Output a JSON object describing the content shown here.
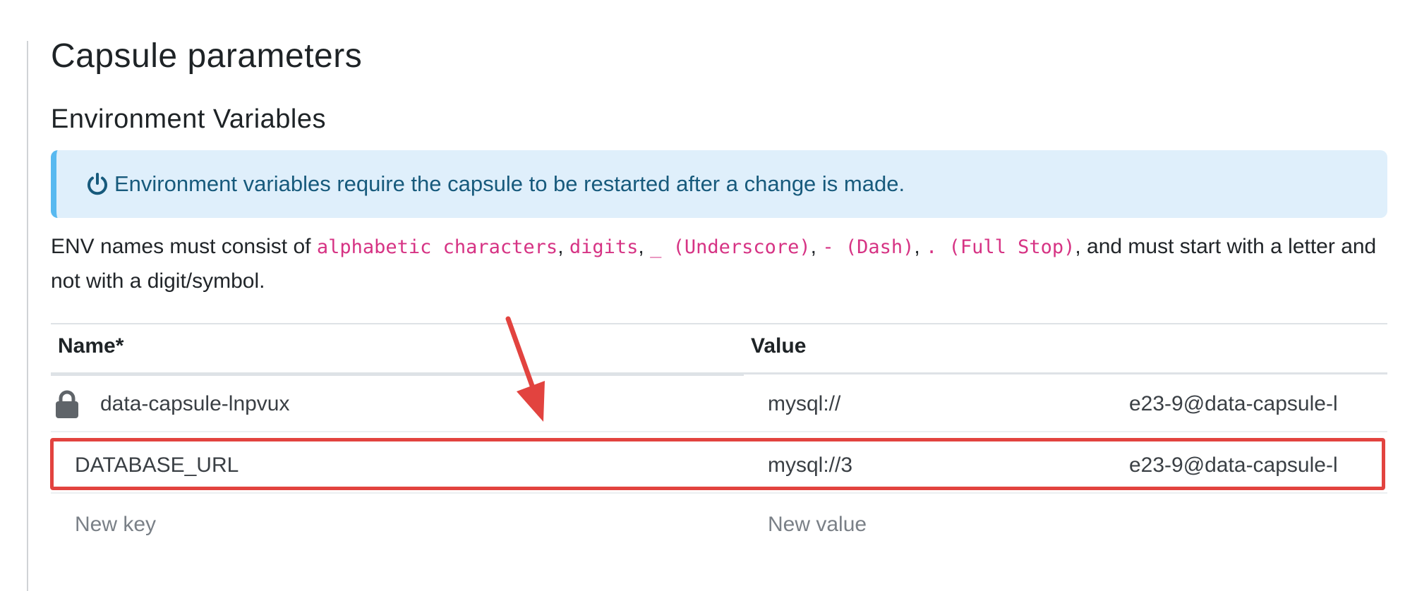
{
  "page": {
    "title": "Capsule parameters",
    "section_title": "Environment Variables"
  },
  "alert": {
    "icon": "power-icon",
    "text": "Environment variables require the capsule to be restarted after a change is made."
  },
  "rules": {
    "prefix": "ENV names must consist of ",
    "allowed": [
      "alphabetic characters",
      "digits",
      "_ (Underscore)",
      "- (Dash)",
      ". (Full Stop)"
    ],
    "separator": ", ",
    "suffix": ", and must start with a letter and not with a digit/symbol."
  },
  "table": {
    "headers": {
      "name": "Name*",
      "value": "Value"
    },
    "rows": [
      {
        "name": "data-capsule-lnpvux",
        "locked": true,
        "value_start": "mysql://",
        "value_end": "e23-9@data-capsule-l"
      },
      {
        "name": "DATABASE_URL",
        "locked": false,
        "value_start": "mysql://3",
        "value_end": "e23-9@data-capsule-l"
      }
    ],
    "new_row": {
      "key_placeholder": "New key",
      "value_placeholder": "New value"
    }
  },
  "colors": {
    "alert_bg": "#dfeffb",
    "alert_accent": "#58b9f0",
    "code": "#d63384",
    "highlight": "#e2433f"
  }
}
